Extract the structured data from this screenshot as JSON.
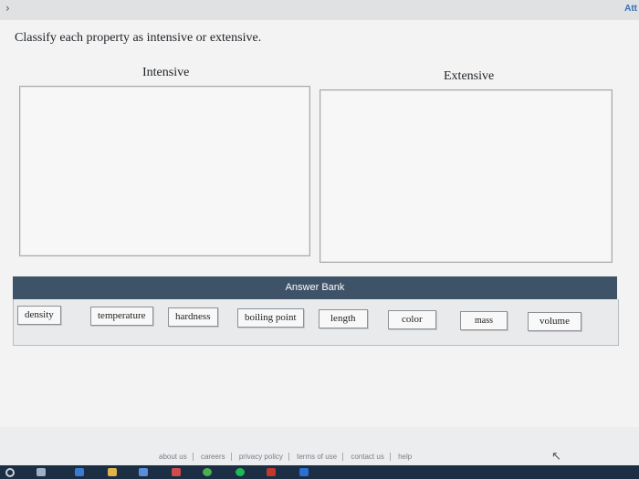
{
  "header": {
    "nav_glyph": "›",
    "right_label": "Att"
  },
  "question": {
    "prompt": "Classify each property as intensive or extensive."
  },
  "columns": {
    "intensive_title": "Intensive",
    "extensive_title": "Extensive"
  },
  "answer_bank": {
    "title": "Answer Bank",
    "items": [
      "density",
      "temperature",
      "hardness",
      "boiling point",
      "length",
      "color",
      "mass",
      "volume"
    ]
  },
  "footer": {
    "links": [
      "about us",
      "careers",
      "privacy policy",
      "terms of use",
      "contact us",
      "help"
    ]
  },
  "cursor_glyph": "↖",
  "taskbar": {
    "icons": [
      "start-icon",
      "task-view-icon",
      "edge-icon",
      "file-explorer-icon",
      "store-icon",
      "mail-icon",
      "chrome-icon",
      "spotify-icon",
      "app-icon",
      "app-icon-2"
    ],
    "colors": [
      "#c9d1db",
      "#9fb0c4",
      "#3a7ad0",
      "#e0b34b",
      "#5a8ed8",
      "#d04b4b",
      "#4caf50",
      "#1db954",
      "#c0392b",
      "#2c6fd1"
    ]
  }
}
